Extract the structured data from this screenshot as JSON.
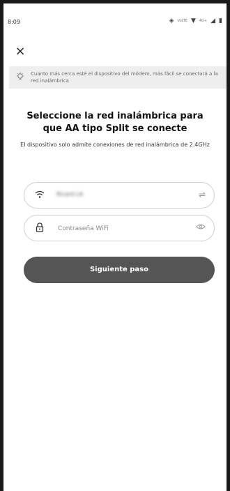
{
  "status_bar": {
    "time": "8:09",
    "volte": "VoLTE",
    "network": "4G+"
  },
  "header": {
    "close_icon": "close-icon"
  },
  "tip": {
    "icon": "lightbulb-icon",
    "text": "Cuanto más cerca esté el dispositivo del módem, más fácil se conectará a la red inalámbrica"
  },
  "main": {
    "title": "Seleccione la red inalámbrica para que AA tipo Split se conecte",
    "subtitle": "El dispositivo solo admite conexiones de red inalámbrica de 2.4GHz"
  },
  "wifi_field": {
    "icon": "wifi-icon",
    "value": "Ricard LA",
    "switch_icon": "switch-network-icon"
  },
  "password_field": {
    "icon": "lock-icon",
    "placeholder": "Contraseña WiFi",
    "visibility_icon": "eye-icon"
  },
  "next_button": {
    "label": "Siguiente paso"
  },
  "colors": {
    "button_bg": "#555555",
    "banner_bg": "#eeeeee",
    "field_border": "#cfcfcf"
  }
}
